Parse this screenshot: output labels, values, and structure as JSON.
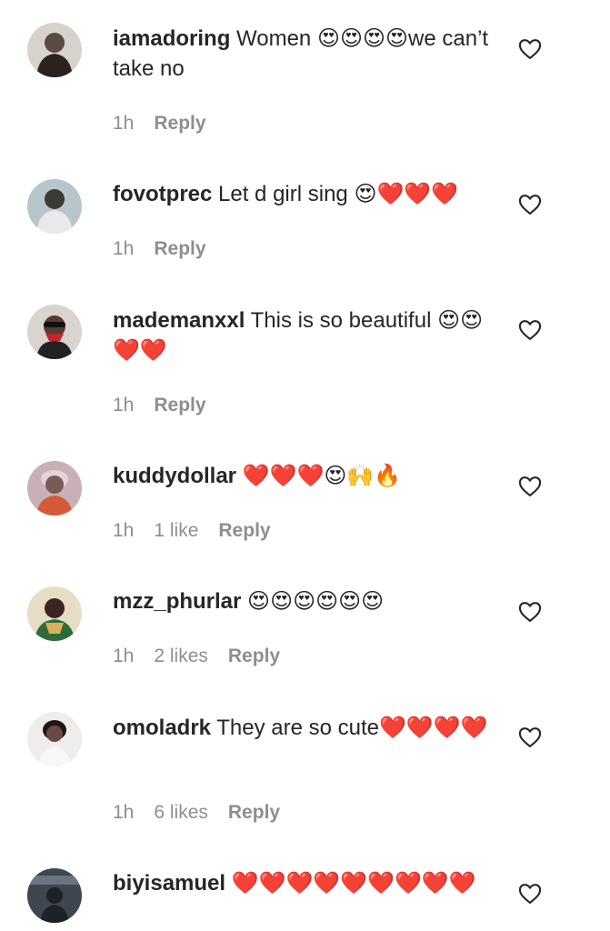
{
  "comments": [
    {
      "username": "iamadoring",
      "text": " Women 😍😍😍😍we can’t take no",
      "time": "1h",
      "likes": "",
      "reply": "Reply",
      "avatar_colors": [
        "#5a4a44",
        "#2b2220"
      ]
    },
    {
      "username": "fovotprec",
      "text": " Let d girl sing 😍❤️❤️❤️",
      "time": "1h",
      "likes": "",
      "reply": "Reply",
      "avatar_colors": [
        "#8fa2a8",
        "#3d3a36"
      ]
    },
    {
      "username": "mademanxxl",
      "text": " This is so beautiful 😍😍❤️❤️",
      "time": "1h",
      "likes": "",
      "reply": "Reply",
      "avatar_colors": [
        "#d9d4cf",
        "#c0262d"
      ]
    },
    {
      "username": "kuddydollar",
      "text": " ❤️❤️❤️😍🙌🔥",
      "time": "1h",
      "likes": "1 like",
      "reply": "Reply",
      "avatar_colors": [
        "#c9b0b7",
        "#7a5a55"
      ]
    },
    {
      "username": "mzz_phurlar",
      "text": " 😍😍😍😍😍😍",
      "time": "1h",
      "likes": "2 likes",
      "reply": "Reply",
      "avatar_colors": [
        "#d8b15a",
        "#2f6b3a"
      ]
    },
    {
      "username": "omoladrk",
      "text": " They are so cute❤️❤️❤️❤️",
      "time": "1h",
      "likes": "6 likes",
      "reply": "Reply",
      "avatar_colors": [
        "#e8e6e4",
        "#3a2a25"
      ]
    },
    {
      "username": "biyisamuel",
      "text": " ❤️❤️❤️❤️❤️❤️❤️❤️❤️",
      "time": "",
      "likes": "",
      "reply": "",
      "avatar_colors": [
        "#3e4650",
        "#1c2228"
      ]
    }
  ],
  "icons": {
    "like": "heart-outline-icon"
  }
}
